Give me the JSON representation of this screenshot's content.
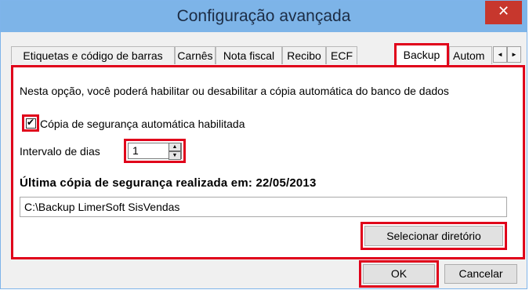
{
  "window": {
    "title": "Configuração avançada",
    "close_glyph": "✕"
  },
  "tabs": [
    {
      "label": "Etiquetas e código de barras",
      "active": false
    },
    {
      "label": "Carnês",
      "active": false
    },
    {
      "label": "Nota fiscal",
      "active": false
    },
    {
      "label": "Recibo",
      "active": false
    },
    {
      "label": "ECF",
      "active": false
    },
    {
      "label": "Backup",
      "active": true
    },
    {
      "label": "Autom",
      "active": false
    }
  ],
  "tab_scroll": {
    "left_glyph": "◄",
    "right_glyph": "►"
  },
  "backup": {
    "description": "Nesta opção, você poderá habilitar ou desabilitar a cópia automática do banco de dados",
    "auto_backup_checked": true,
    "auto_backup_mark": "✔",
    "auto_backup_label": "Cópia de segurança automática habilitada",
    "interval_label": "Intervalo de dias",
    "interval_value": "1",
    "spin_up_glyph": "▲",
    "spin_down_glyph": "▼",
    "last_backup_label": "Última cópia de segurança realizada em: 22/05/2013",
    "directory_value": "C:\\Backup LimerSoft SisVendas",
    "select_directory_label": "Selecionar diretório"
  },
  "footer": {
    "ok_label": "OK",
    "cancel_label": "Cancelar"
  },
  "colors": {
    "titlebar": "#7db4e8",
    "close": "#c7372d",
    "highlight": "#e0001a"
  }
}
